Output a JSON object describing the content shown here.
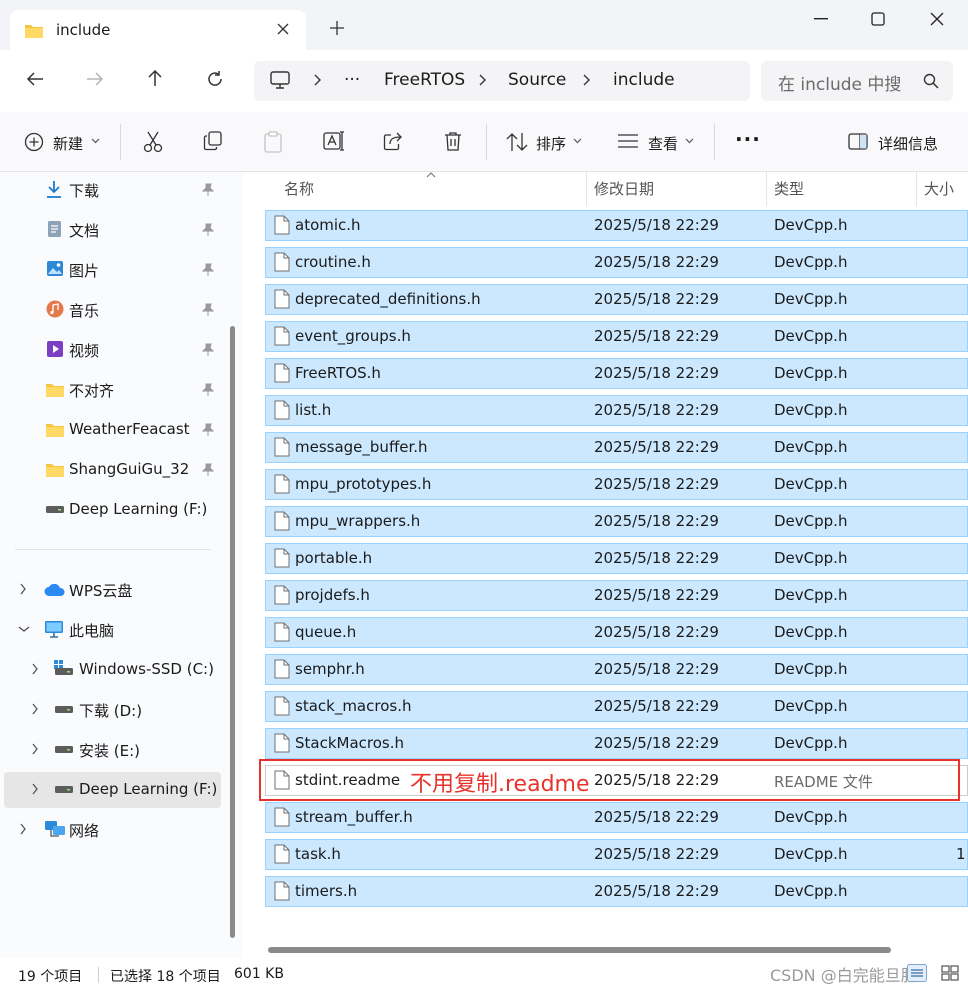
{
  "window": {
    "tab_title": "include",
    "tab_icon": "folder-icon"
  },
  "address": {
    "breadcrumbs": [
      "FreeRTOS",
      "Source",
      "include"
    ],
    "overflow": "···",
    "search_placeholder": "在 include 中搜"
  },
  "toolbar": {
    "new_label": "新建",
    "sort_label": "排序",
    "view_label": "查看",
    "more_label": "···",
    "details_label": "详细信息"
  },
  "nav": {
    "quick": [
      {
        "label": "下载",
        "icon": "download-icon"
      },
      {
        "label": "文档",
        "icon": "document-icon"
      },
      {
        "label": "图片",
        "icon": "pictures-icon"
      },
      {
        "label": "音乐",
        "icon": "music-icon"
      },
      {
        "label": "视频",
        "icon": "video-icon"
      },
      {
        "label": "不对齐",
        "icon": "folder-icon"
      },
      {
        "label": "WeatherFeacast",
        "icon": "folder-icon"
      },
      {
        "label": "ShangGuiGu_32",
        "icon": "folder-icon"
      },
      {
        "label": "Deep Learning (F:)",
        "icon": "drive-icon"
      }
    ],
    "tree": [
      {
        "label": "WPS云盘",
        "icon": "cloud-icon"
      },
      {
        "label": "此电脑",
        "icon": "computer-icon"
      },
      {
        "label": "Windows-SSD (C:)",
        "icon": "windows-drive-icon"
      },
      {
        "label": "下载 (D:)",
        "icon": "drive-icon"
      },
      {
        "label": "安装 (E:)",
        "icon": "drive-icon"
      },
      {
        "label": "Deep Learning (F:)",
        "icon": "drive-icon"
      },
      {
        "label": "网络",
        "icon": "network-icon"
      }
    ]
  },
  "columns": {
    "name": "名称",
    "date": "修改日期",
    "type": "类型",
    "size": "大小"
  },
  "files": [
    {
      "name": "atomic.h",
      "date": "2025/5/18 22:29",
      "type": "DevCpp.h",
      "size": ""
    },
    {
      "name": "croutine.h",
      "date": "2025/5/18 22:29",
      "type": "DevCpp.h",
      "size": ""
    },
    {
      "name": "deprecated_definitions.h",
      "date": "2025/5/18 22:29",
      "type": "DevCpp.h",
      "size": ""
    },
    {
      "name": "event_groups.h",
      "date": "2025/5/18 22:29",
      "type": "DevCpp.h",
      "size": ""
    },
    {
      "name": "FreeRTOS.h",
      "date": "2025/5/18 22:29",
      "type": "DevCpp.h",
      "size": ""
    },
    {
      "name": "list.h",
      "date": "2025/5/18 22:29",
      "type": "DevCpp.h",
      "size": ""
    },
    {
      "name": "message_buffer.h",
      "date": "2025/5/18 22:29",
      "type": "DevCpp.h",
      "size": ""
    },
    {
      "name": "mpu_prototypes.h",
      "date": "2025/5/18 22:29",
      "type": "DevCpp.h",
      "size": ""
    },
    {
      "name": "mpu_wrappers.h",
      "date": "2025/5/18 22:29",
      "type": "DevCpp.h",
      "size": ""
    },
    {
      "name": "portable.h",
      "date": "2025/5/18 22:29",
      "type": "DevCpp.h",
      "size": ""
    },
    {
      "name": "projdefs.h",
      "date": "2025/5/18 22:29",
      "type": "DevCpp.h",
      "size": ""
    },
    {
      "name": "queue.h",
      "date": "2025/5/18 22:29",
      "type": "DevCpp.h",
      "size": ""
    },
    {
      "name": "semphr.h",
      "date": "2025/5/18 22:29",
      "type": "DevCpp.h",
      "size": ""
    },
    {
      "name": "stack_macros.h",
      "date": "2025/5/18 22:29",
      "type": "DevCpp.h",
      "size": ""
    },
    {
      "name": "StackMacros.h",
      "date": "2025/5/18 22:29",
      "type": "DevCpp.h",
      "size": ""
    },
    {
      "name": "stdint.readme",
      "date": "2025/5/18 22:29",
      "type": "README 文件",
      "size": "",
      "selected": false
    },
    {
      "name": "stream_buffer.h",
      "date": "2025/5/18 22:29",
      "type": "DevCpp.h",
      "size": ""
    },
    {
      "name": "task.h",
      "date": "2025/5/18 22:29",
      "type": "DevCpp.h",
      "size": "1"
    },
    {
      "name": "timers.h",
      "date": "2025/5/18 22:29",
      "type": "DevCpp.h",
      "size": ""
    }
  ],
  "annotation": {
    "text": "不用复制.readme",
    "color": "#e8332c"
  },
  "status": {
    "item_count": "19 个项目",
    "selection": "已选择 18 个项目",
    "size": "601 KB"
  },
  "watermark": "CSDN @白完能旦肥",
  "colors": {
    "selection_bg": "#cce8ff",
    "selection_border": "#99d1ff",
    "folder": "#f4c542"
  }
}
